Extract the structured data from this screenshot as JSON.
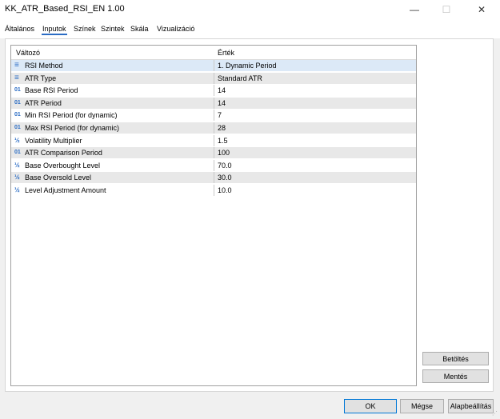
{
  "window": {
    "title": "KK_ATR_Based_RSI_EN 1.00",
    "minimize_glyph": "—",
    "maximize_glyph": "☐",
    "close_glyph": "✕"
  },
  "tabs": [
    {
      "label": "Általános",
      "active": false
    },
    {
      "label": "Inputok",
      "active": true
    },
    {
      "label": "Színek",
      "active": false
    },
    {
      "label": "Szintek",
      "active": false
    },
    {
      "label": "Skála",
      "active": false
    },
    {
      "label": "Vizualizáció",
      "active": false
    }
  ],
  "grid": {
    "columns": {
      "variable": "Változó",
      "value": "Érték"
    },
    "rows": [
      {
        "icon": "enum-icon",
        "glyph": "≡",
        "variable": "RSI Method",
        "value": "1. Dynamic Period"
      },
      {
        "icon": "enum-icon",
        "glyph": "≡",
        "variable": "ATR Type",
        "value": "Standard ATR"
      },
      {
        "icon": "integer-icon",
        "glyph": "01",
        "variable": "Base RSI Period",
        "value": "14"
      },
      {
        "icon": "integer-icon",
        "glyph": "01",
        "variable": "ATR Period",
        "value": "14"
      },
      {
        "icon": "integer-icon",
        "glyph": "01",
        "variable": "Min RSI Period (for dynamic)",
        "value": "7"
      },
      {
        "icon": "integer-icon",
        "glyph": "01",
        "variable": "Max RSI Period (for dynamic)",
        "value": "28"
      },
      {
        "icon": "double-icon",
        "glyph": "½",
        "variable": "Volatility Multiplier",
        "value": "1.5"
      },
      {
        "icon": "integer-icon",
        "glyph": "01",
        "variable": "ATR Comparison Period",
        "value": "100"
      },
      {
        "icon": "double-icon",
        "glyph": "½",
        "variable": "Base Overbought Level",
        "value": "70.0"
      },
      {
        "icon": "double-icon",
        "glyph": "½",
        "variable": "Base Oversold Level",
        "value": "30.0"
      },
      {
        "icon": "double-icon",
        "glyph": "½",
        "variable": "Level Adjustment Amount",
        "value": "10.0"
      }
    ]
  },
  "side_buttons": {
    "load": "Betöltés",
    "save": "Mentés"
  },
  "footer": {
    "ok": "OK",
    "cancel": "Mégse",
    "reset": "Alapbeállítás"
  },
  "colors": {
    "accent": "#2b6cc4",
    "selected_row": "#dce9f7",
    "alt_row": "#e8e8e8"
  }
}
